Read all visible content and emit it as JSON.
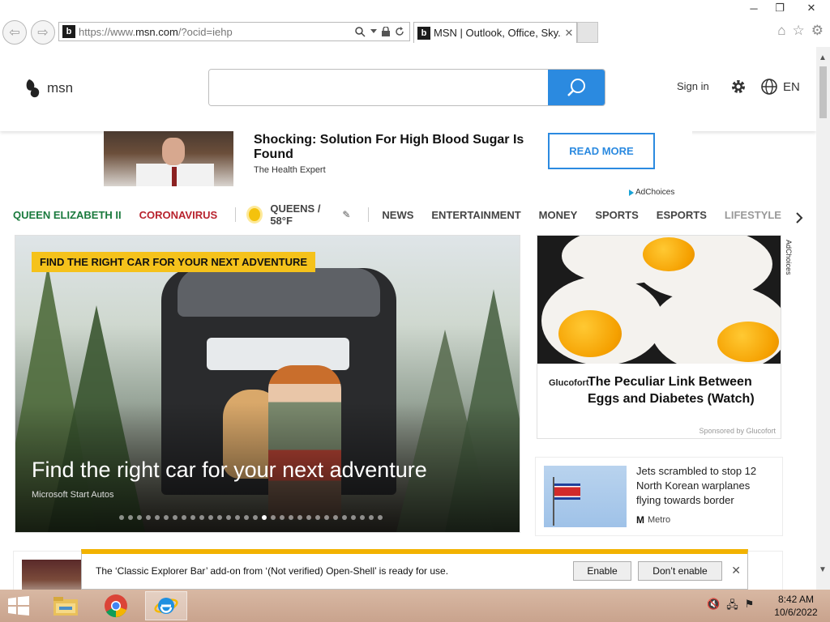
{
  "window": {
    "min_glyph": "─",
    "restore_glyph": "❐",
    "close_glyph": "✕"
  },
  "browser": {
    "url_prefix": "https://www.",
    "url_domain": "msn.com",
    "url_suffix": "/?ocid=iehp",
    "favicon_letter": "b",
    "tab_title": "MSN | Outlook, Office, Sky...",
    "back_glyph": "⇦",
    "forward_glyph": "⇨",
    "home_glyph": "⌂",
    "star_glyph": "☆",
    "gear_glyph": "⚙"
  },
  "header": {
    "logo_text": "msn",
    "search_placeholder": "",
    "signin_label": "Sign in",
    "language_label": "EN"
  },
  "ad_banner": {
    "title": "Shocking: Solution For High Blood Sugar Is Found",
    "source": "The Health Expert",
    "cta_label": "READ MORE",
    "adchoices_label": "AdChoices"
  },
  "nav": {
    "items": [
      {
        "label": "QUEEN ELIZABETH II"
      },
      {
        "label": "CORONAVIRUS"
      },
      {
        "label": "QUEENS / 58°F"
      },
      {
        "label": "NEWS"
      },
      {
        "label": "ENTERTAINMENT"
      },
      {
        "label": "MONEY"
      },
      {
        "label": "SPORTS"
      },
      {
        "label": "ESPORTS"
      },
      {
        "label": "LIFESTYLE"
      }
    ],
    "next_glyph": "›",
    "pencil_glyph": "✎"
  },
  "hero": {
    "tag": "FIND THE RIGHT CAR FOR YOUR NEXT ADVENTURE",
    "title": "Find the right car for your next adventure",
    "source": "Microsoft Start Autos",
    "dots_total": 30,
    "active_dot": 16
  },
  "egg_ad": {
    "brand": "Glucofort",
    "title": "The Peculiar Link Between Eggs and Diabetes (Watch)",
    "sponsor": "Sponsored by Glucofort",
    "side_adchoices": "AdChoices"
  },
  "news_card": {
    "title": "Jets scrambled to stop 12 North Korean warplanes flying towards border",
    "source": "Metro",
    "source_logo": "M"
  },
  "notification": {
    "message": "The ‘Classic Explorer Bar’ add-on from ‘(Not verified) Open-Shell’ is ready for use.",
    "enable_label": "Enable",
    "dont_enable_label": "Don’t enable",
    "close_glyph": "✕"
  },
  "taskbar": {
    "time": "8:42 AM",
    "date": "10/6/2022",
    "tray_icons": [
      "🔇",
      "🖧",
      "⚑"
    ]
  },
  "colors": {
    "accent": "#2b8ae0",
    "tag_yellow": "#f5c21b",
    "notif_yellow": "#f2b200",
    "nav_green": "#1a7a3d",
    "nav_red": "#b8232e"
  }
}
